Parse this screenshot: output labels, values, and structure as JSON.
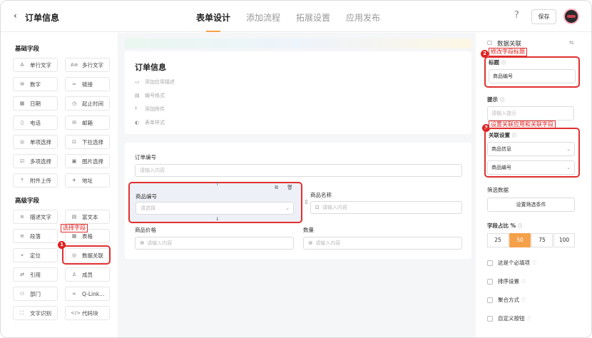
{
  "header": {
    "back_icon": "‹",
    "title": "订单信息",
    "tabs": [
      {
        "label": "表单设计"
      },
      {
        "label": "添加流程"
      },
      {
        "label": "拓展设置"
      },
      {
        "label": "应用发布"
      }
    ],
    "help_icon": "?",
    "save_label": "保存"
  },
  "left": {
    "basic_title": "基础字段",
    "basic_fields": [
      {
        "label": "单行文字",
        "icon": "A"
      },
      {
        "label": "多行文字",
        "icon": "A≡"
      },
      {
        "label": "数字",
        "icon": "⑩"
      },
      {
        "label": "链接",
        "icon": "∞"
      },
      {
        "label": "日期",
        "icon": "▦"
      },
      {
        "label": "起止时间",
        "icon": "◷"
      },
      {
        "label": "电话",
        "icon": "▯"
      },
      {
        "label": "邮箱",
        "icon": "✉"
      },
      {
        "label": "单项选择",
        "icon": "◎"
      },
      {
        "label": "下拉选择",
        "icon": "⊡"
      },
      {
        "label": "多项选择",
        "icon": "☑"
      },
      {
        "label": "图片选择",
        "icon": "▣"
      },
      {
        "label": "附件上传",
        "icon": "⤒"
      },
      {
        "label": "地址",
        "icon": "✈"
      }
    ],
    "advanced_title": "高级字段",
    "advanced_fields": [
      {
        "label": "描述文字",
        "icon": "≡"
      },
      {
        "label": "富文本",
        "icon": "▤"
      },
      {
        "label": "段落",
        "icon": "≡"
      },
      {
        "label": "表格",
        "icon": "▦"
      },
      {
        "label": "定位",
        "icon": "⌖"
      },
      {
        "label": "数据关联",
        "icon": "◎"
      },
      {
        "label": "引用",
        "icon": "⇄"
      },
      {
        "label": "成员",
        "icon": "♙"
      },
      {
        "label": "部门",
        "icon": "⚇"
      },
      {
        "label": "Q-Link...",
        "icon": "∞"
      },
      {
        "label": "文字识别",
        "icon": "⛶"
      },
      {
        "label": "代码块",
        "icon": "</>"
      }
    ],
    "annotation_select": "选择字段",
    "badge_1": "1"
  },
  "canvas": {
    "form_title": "订单信息",
    "options": [
      {
        "label": "添加应用描述",
        "icon": "▭"
      },
      {
        "label": "编号格式",
        "icon": "▤"
      },
      {
        "label": "添加附件",
        "icon": "⤒"
      },
      {
        "label": "表单样式",
        "icon": "◐"
      }
    ],
    "fields": [
      {
        "label": "订单编号",
        "placeholder": "请输入内容"
      },
      {
        "label": "商品编号",
        "placeholder": "请选择"
      },
      {
        "label": "商品名称",
        "placeholder": "请输入内容"
      },
      {
        "label": "商品价格",
        "placeholder": "请输入内容"
      },
      {
        "label": "数量",
        "placeholder": "请输入内容"
      }
    ]
  },
  "right": {
    "header_icon": "▢",
    "header_label": "数据关联",
    "swap_icon": "⇆",
    "annotation_title": "修改字段标题",
    "badge_2": "2",
    "title_label": "标题",
    "title_value": "商品编号",
    "hint_label": "提示",
    "hint_placeholder": "请输入提示",
    "annotation_link": "设置关联应用和关联字段",
    "badge_3": "3",
    "link_label": "关联设置",
    "link_app": "商品信息",
    "link_field": "商品编号",
    "filter_label": "筛选数据",
    "filter_button": "设置筛选条件",
    "ratio_label": "字段占比 %",
    "ratios": [
      "25",
      "50",
      "75",
      "100"
    ],
    "selected_ratio": "50",
    "checks": [
      {
        "label": "这是个必填项"
      },
      {
        "label": "排序设置"
      },
      {
        "label": "聚合方式"
      },
      {
        "label": "自定义按钮"
      }
    ]
  },
  "colors": {
    "accent": "#f5a14a",
    "annotation_red": "#e03030",
    "canvas_bg": "#f5f6f8"
  }
}
